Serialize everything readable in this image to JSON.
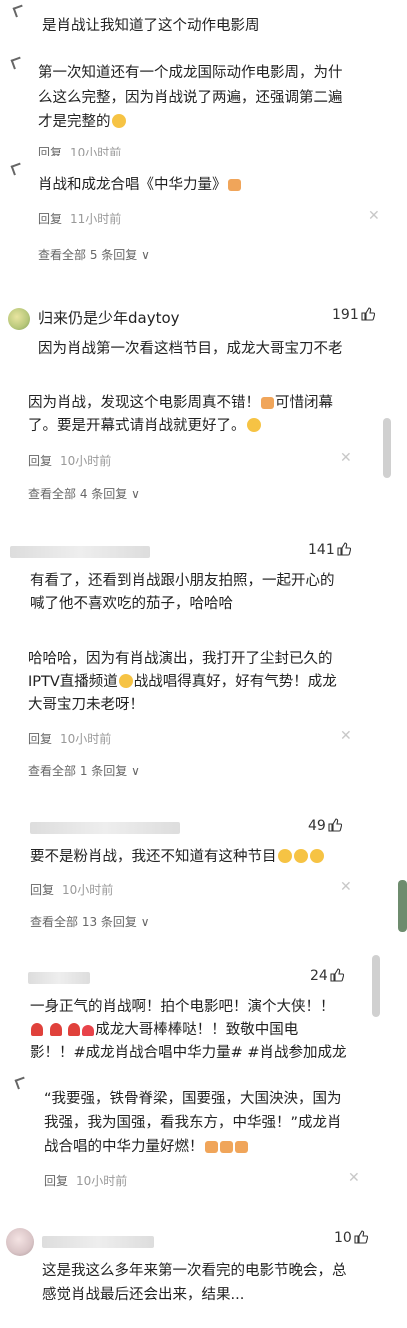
{
  "c1": {
    "text": "是肖战让我知道了这个动作电影周"
  },
  "c2": {
    "l1": "第一次知道还有一个成龙国际动作电影周，为什",
    "l2": "么这么完整，因为肖战说了两遍，还强调第二遍",
    "l3": "才是完整的",
    "reply": "回复",
    "time": "10小时前"
  },
  "c3": {
    "text": "肖战和成龙合唱《中华力量》",
    "reply": "回复",
    "time": "11小时前",
    "more": "查看全部 5 条回复"
  },
  "c4": {
    "user": "归来仍是少年daytoy",
    "likes": "191",
    "text": "因为肖战第一次看这档节目，成龙大哥宝刀不老"
  },
  "c5": {
    "l1": "因为肖战，发现这个电影周真不错！",
    "l1b": "可惜闭幕",
    "l2": "了。要是开幕式请肖战就更好了。",
    "reply": "回复",
    "time": "10小时前",
    "more": "查看全部 4 条回复"
  },
  "c6": {
    "likes": "141",
    "l1": "有看了，还看到肖战跟小朋友拍照，一起开心的",
    "l2": "喊了他不喜欢吃的茄子，哈哈哈"
  },
  "c7": {
    "l1": "哈哈哈，因为有肖战演出，我打开了尘封已久的",
    "l2a": "IPTV直播频道",
    "l2b": "战战唱得真好，好有气势！成龙",
    "l3": "大哥宝刀未老呀！",
    "reply": "回复",
    "time": "10小时前",
    "more": "查看全部 1 条回复"
  },
  "c8": {
    "likes": "49",
    "text": "要不是粉肖战，我还不知道有这种节目",
    "reply": "回复",
    "time": "10小时前",
    "more": "查看全部 13 条回复"
  },
  "c9": {
    "likes": "24",
    "l1": "一身正气的肖战啊！拍个电影吧！演个大侠！！",
    "l2": "成龙大哥棒棒哒！！致敬中国电",
    "l3": "影！！#成龙肖战合唱中华力量# #肖战参加成龙"
  },
  "c10": {
    "l1": "“我要强，铁骨脊梁，国要强，大国泱泱，国为",
    "l2": "我强，我为国强，看我东方，中华强！”成龙肖",
    "l3": "战合唱的中华力量好燃！",
    "reply": "回复",
    "time": "10小时前"
  },
  "c11": {
    "likes": "10",
    "l1": "这是我这么多年来第一次看完的电影节晚会，总",
    "l2": "感觉肖战最后还会出来，结果..."
  },
  "icons": {
    "close": "✕",
    "chevron": "∨"
  }
}
